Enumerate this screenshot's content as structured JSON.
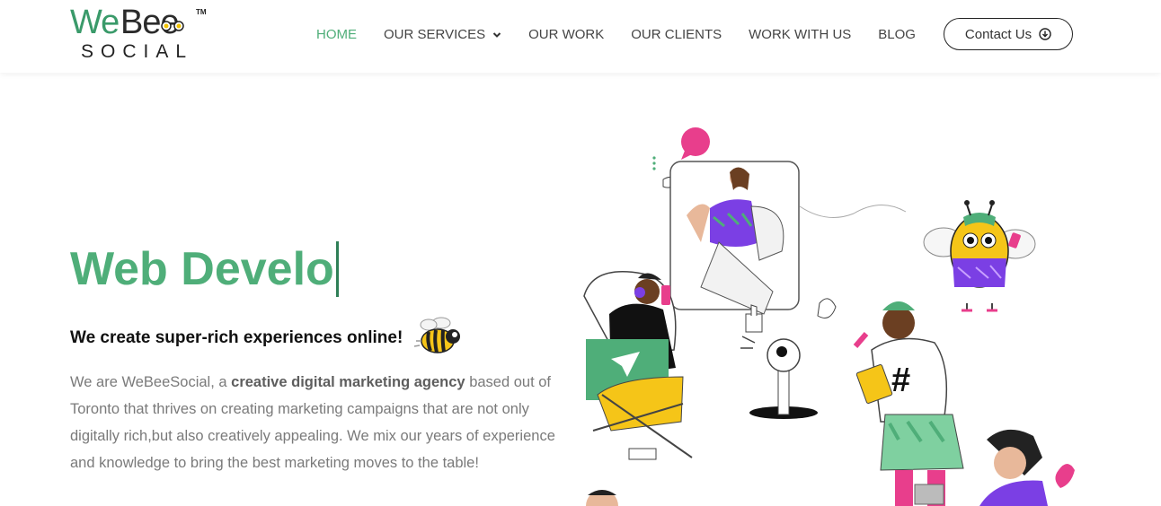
{
  "logo": {
    "we": "We",
    "bee": "Bee",
    "tm": "TM",
    "social": "SOCIAL"
  },
  "nav": {
    "items": [
      {
        "label": "HOME",
        "active": true
      },
      {
        "label": "OUR SERVICES",
        "has_dropdown": true
      },
      {
        "label": "OUR WORK"
      },
      {
        "label": "OUR CLIENTS"
      },
      {
        "label": "WORK WITH US"
      },
      {
        "label": "BLOG"
      }
    ],
    "contact_label": "Contact Us"
  },
  "hero": {
    "title": "Web Develo",
    "tagline": "We create super-rich experiences online!",
    "intro_pre": "We are WeBeeSocial, a ",
    "intro_bold": "creative digital marketing agency",
    "intro_post": " based out of Toronto that thrives on creating marketing campaigns that are not only digitally rich,but also creatively appealing. We mix our years of experience and knowledge to bring the best marketing moves to the table!"
  },
  "colors": {
    "brand_green": "#4fae79",
    "text_gray": "#7a7a7a",
    "dark": "#222222",
    "accent_pink": "#e83e8c",
    "accent_purple": "#7b3fe4"
  },
  "icons": [
    "chevron-down-icon",
    "download-circle-icon",
    "bee-illustration",
    "hashtag-icon",
    "like-icon",
    "heart-icon",
    "send-icon"
  ]
}
